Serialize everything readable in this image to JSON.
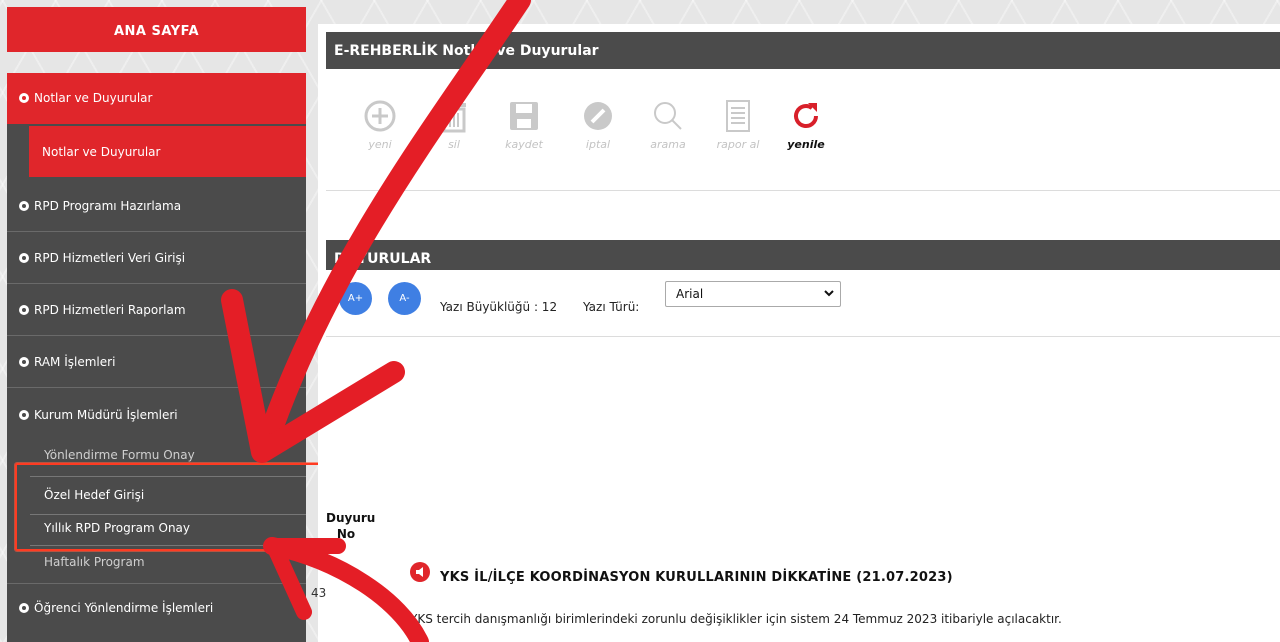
{
  "home": {
    "label": "ANA SAYFA"
  },
  "sidebar": {
    "items": [
      {
        "label": "Notlar ve Duyurular"
      },
      {
        "label": "Notlar ve Duyurular"
      },
      {
        "label": "RPD Programı Hazırlama"
      },
      {
        "label": "RPD Hizmetleri Veri Girişi"
      },
      {
        "label": "RPD Hizmetleri Raporlam"
      },
      {
        "label": "RAM İşlemleri"
      },
      {
        "label": "Kurum Müdürü İşlemleri"
      },
      {
        "label": "Yönlendirme Formu Onay"
      },
      {
        "label": "Özel Hedef Girişi"
      },
      {
        "label": "Yıllık RPD Program Onay"
      },
      {
        "label": "Haftalık Program"
      },
      {
        "label": "Öğrenci Yönlendirme İşlemleri"
      }
    ]
  },
  "main": {
    "title": "E-REHBERLİK Notlar ve Duyurular",
    "toolbar": {
      "yeni": "yeni",
      "sil": "sil",
      "kaydet": "kaydet",
      "iptal": "iptal",
      "arama": "arama",
      "rapor": "rapor al",
      "yenile": "yenile"
    },
    "section_title": "DUYURULAR",
    "font_increase": "A+",
    "font_decrease": "A-",
    "font_size_label": "Yazı Büyüklüğü : 12",
    "font_type_label": "Yazı Türü:",
    "font_type_value": "Arial",
    "col_header_line1": "Duyuru",
    "col_header_line2": "No",
    "row_no": "43",
    "announcement_title": "YKS İL/İLÇE KOORDİNASYON KURULLARININ DİKKATİNE (21.07.2023)",
    "announcement_body": "YKS tercih danışmanlığı birimlerindeki zorunlu değişiklikler için sistem 24 Temmuz 2023 itibariyle açılacaktır."
  },
  "colors": {
    "accent": "#e0262b",
    "sidebar": "#4b4b4b",
    "button": "#3f7fe3",
    "arrow": "#e41e26"
  },
  "icons": [
    "plus-icon",
    "trash-icon",
    "floppy-icon",
    "cancel-icon",
    "search-icon",
    "report-icon",
    "refresh-icon",
    "megaphone-icon",
    "chevron-down-icon"
  ]
}
